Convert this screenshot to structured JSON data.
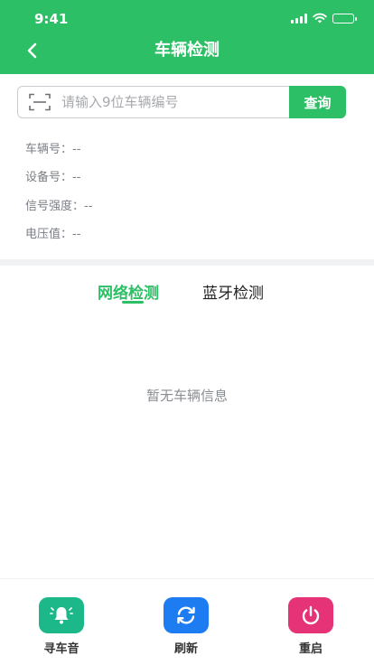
{
  "status_bar": {
    "time": "9:41"
  },
  "header": {
    "title": "车辆检测",
    "back_icon": "chevron-left-icon"
  },
  "search": {
    "placeholder": "请输入9位车辆编号",
    "value": "",
    "button_label": "查询",
    "scan_icon": "scan-icon"
  },
  "info": [
    {
      "label": "车辆号：",
      "value": "--"
    },
    {
      "label": "设备号：",
      "value": "--"
    },
    {
      "label": "信号强度：",
      "value": "--"
    },
    {
      "label": "电压值：",
      "value": "--"
    }
  ],
  "tabs": [
    {
      "label": "网络检测",
      "active": true
    },
    {
      "label": "蓝牙检测",
      "active": false
    }
  ],
  "empty_message": "暂无车辆信息",
  "actions": [
    {
      "label": "寻车音",
      "icon": "bell-icon",
      "color": "#1cb88a"
    },
    {
      "label": "刷新",
      "icon": "refresh-icon",
      "color": "#1e7cf2"
    },
    {
      "label": "重启",
      "icon": "power-icon",
      "color": "#e63276"
    }
  ],
  "colors": {
    "accent": "#2dbf65",
    "divider": "#f1f2f4"
  }
}
